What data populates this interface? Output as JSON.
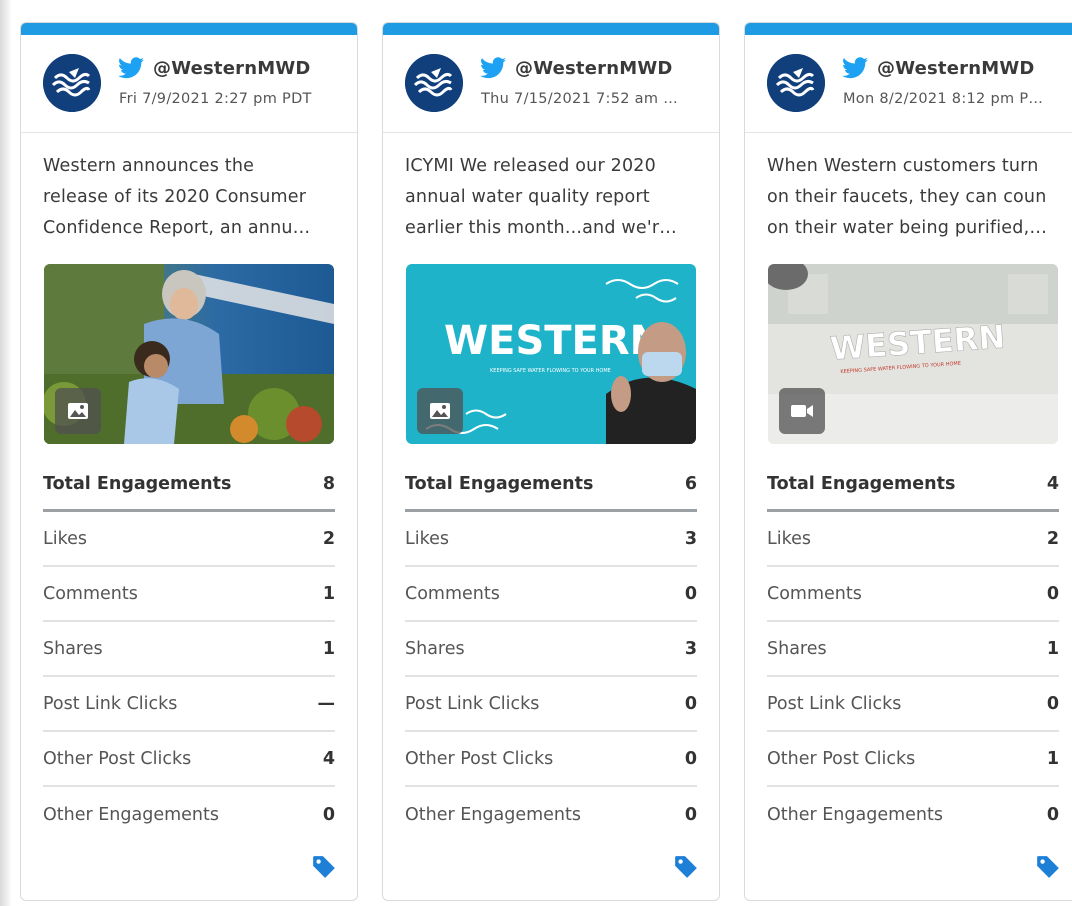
{
  "colors": {
    "accent": "#1e9be3",
    "twitter": "#1da1f2",
    "tag": "#1e7fd6",
    "avatar_bg": "#103f7c"
  },
  "cards": [
    {
      "handle": "@WesternMWD",
      "date": "Fri 7/9/2021 2:27 pm PDT",
      "text_lines": [
        "Western announces the",
        "release of its 2020 Consumer",
        "Confidence Report, an annu…"
      ],
      "media_type": "image-icon",
      "stats": {
        "total_label": "Total Engagements",
        "total_value": "8",
        "rows": [
          {
            "label": "Likes",
            "value": "2"
          },
          {
            "label": "Comments",
            "value": "1"
          },
          {
            "label": "Shares",
            "value": "1"
          },
          {
            "label": "Post Link Clicks",
            "value": "—"
          },
          {
            "label": "Other Post Clicks",
            "value": "4"
          },
          {
            "label": "Other Engagements",
            "value": "0"
          }
        ]
      }
    },
    {
      "handle": "@WesternMWD",
      "date": "Thu 7/15/2021 7:52 am …",
      "text_lines": [
        "ICYMI We released our 2020",
        "annual water quality report",
        "earlier this month...and we'r…"
      ],
      "media_type": "image-icon",
      "media_title": "WESTERN",
      "media_subtitle": "KEEPING SAFE WATER FLOWING TO YOUR HOME",
      "stats": {
        "total_label": "Total Engagements",
        "total_value": "6",
        "rows": [
          {
            "label": "Likes",
            "value": "3"
          },
          {
            "label": "Comments",
            "value": "0"
          },
          {
            "label": "Shares",
            "value": "3"
          },
          {
            "label": "Post Link Clicks",
            "value": "0"
          },
          {
            "label": "Other Post Clicks",
            "value": "0"
          },
          {
            "label": "Other Engagements",
            "value": "0"
          }
        ]
      }
    },
    {
      "handle": "@WesternMWD",
      "date": "Mon 8/2/2021 8:12 pm P…",
      "text_lines": [
        "When Western customers turn",
        "on their faucets, they can coun",
        "on their water being purified,…"
      ],
      "media_type": "video-icon",
      "media_title": "WESTERN",
      "media_subtitle": "KEEPING SAFE WATER FLOWING TO YOUR HOME",
      "stats": {
        "total_label": "Total Engagements",
        "total_value": "4",
        "rows": [
          {
            "label": "Likes",
            "value": "2"
          },
          {
            "label": "Comments",
            "value": "0"
          },
          {
            "label": "Shares",
            "value": "1"
          },
          {
            "label": "Post Link Clicks",
            "value": "0"
          },
          {
            "label": "Other Post Clicks",
            "value": "1"
          },
          {
            "label": "Other Engagements",
            "value": "0"
          }
        ]
      }
    }
  ]
}
